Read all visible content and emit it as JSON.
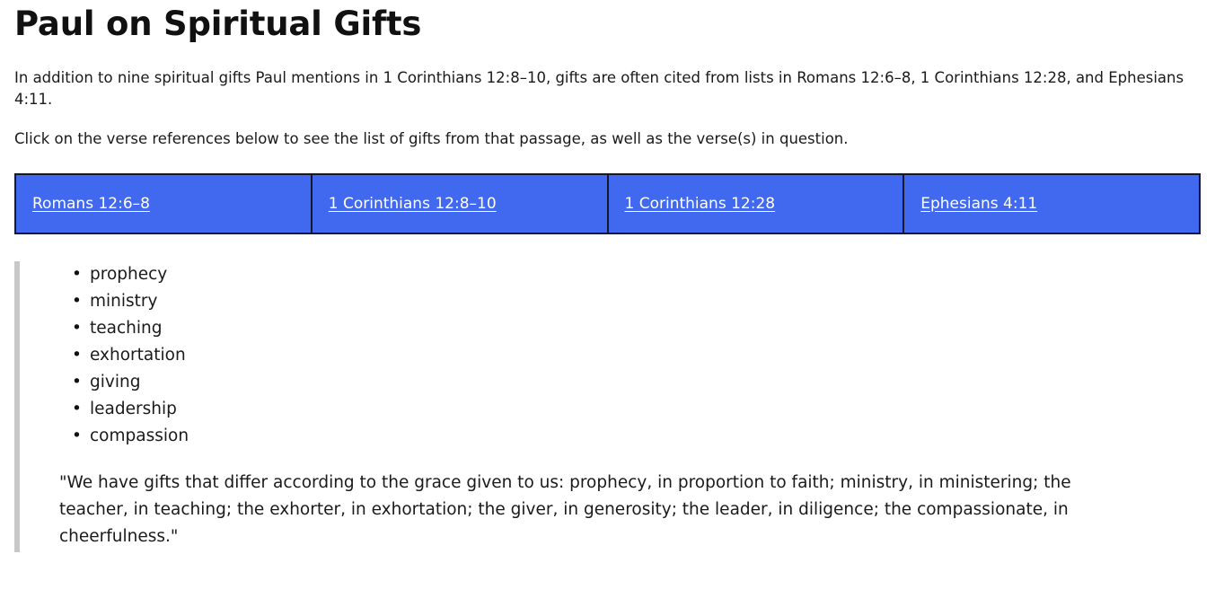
{
  "page": {
    "title": "Paul on Spiritual Gifts",
    "intro_paragraph_1": "In addition to nine spiritual gifts Paul mentions in 1 Corinthians 12:8–10, gifts are often cited from lists in Romans 12:6–8, 1 Corinthians 12:28, and Ephesians 4:11.",
    "intro_paragraph_2": "Click on the verse references below to see the list of gifts from that passage, as well as the verse(s) in question."
  },
  "colors": {
    "tab_background": "#4169F0",
    "tab_border": "#15172B",
    "tab_link_text": "#FFFFFF",
    "panel_rule": "#C8C8C8",
    "body_text": "#1A1A1A"
  },
  "tabs": [
    {
      "label": "Romans 12:6–8"
    },
    {
      "label": "1 Corinthians 12:8–10"
    },
    {
      "label": "1 Corinthians 12:28"
    },
    {
      "label": "Ephesians 4:11"
    }
  ],
  "panel": {
    "gifts": [
      "prophecy",
      "ministry",
      "teaching",
      "exhortation",
      "giving",
      "leadership",
      "compassion"
    ],
    "quote": "\"We have gifts that differ according to the grace given to us: prophecy, in proportion to faith; ministry, in ministering; the teacher, in teaching; the exhorter, in exhortation; the giver, in generosity; the leader, in diligence; the compassionate, in cheerfulness.\""
  }
}
